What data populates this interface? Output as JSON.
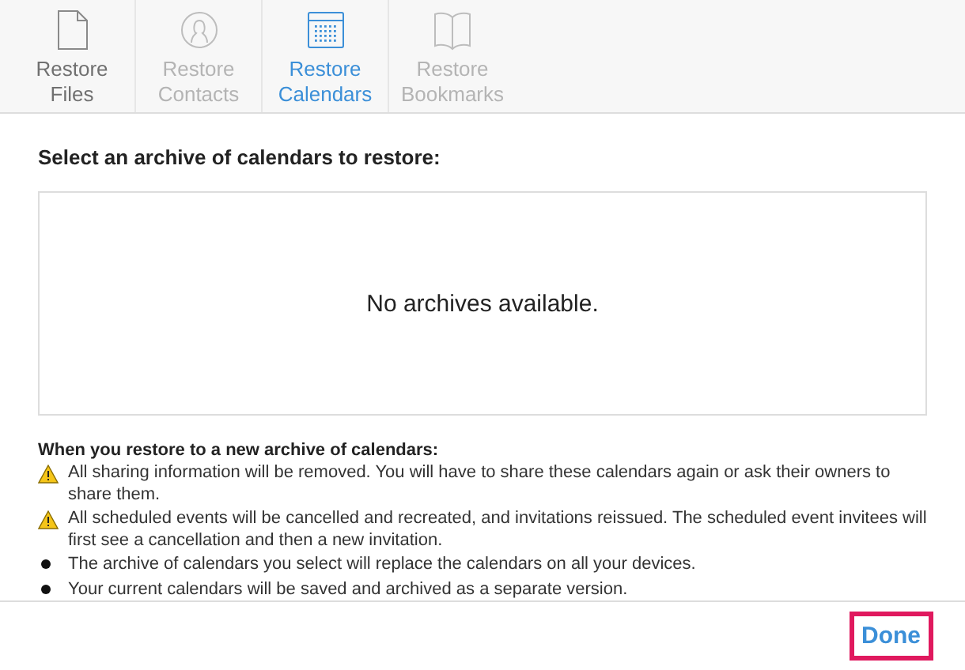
{
  "tabs": [
    {
      "kind": "file",
      "label": "Restore Files",
      "selected": false,
      "disabled": false
    },
    {
      "kind": "contacts",
      "label": "Restore Contacts",
      "selected": false,
      "disabled": true
    },
    {
      "kind": "calendar",
      "label": "Restore Calendars",
      "selected": true,
      "disabled": false
    },
    {
      "kind": "book",
      "label": "Restore Bookmarks",
      "selected": false,
      "disabled": true
    }
  ],
  "prompt": "Select an archive of calendars to restore:",
  "archive_list": {
    "empty_message": "No archives available."
  },
  "notes": {
    "heading": "When you restore to a new archive of calendars:",
    "items": [
      {
        "kind": "warning",
        "text": "All sharing information will be removed. You will have to share these calendars again or ask their owners to share them."
      },
      {
        "kind": "warning",
        "text": "All scheduled events will be cancelled and recreated, and invitations reissued. The scheduled event invitees will first see a cancellation and then a new invitation."
      },
      {
        "kind": "bullet",
        "text": "The archive of calendars you select will replace the calendars on all your devices."
      },
      {
        "kind": "bullet",
        "text": "Your current calendars will be saved and archived as a separate version."
      }
    ]
  },
  "done_button": {
    "label": "Done",
    "highlighted": true
  }
}
